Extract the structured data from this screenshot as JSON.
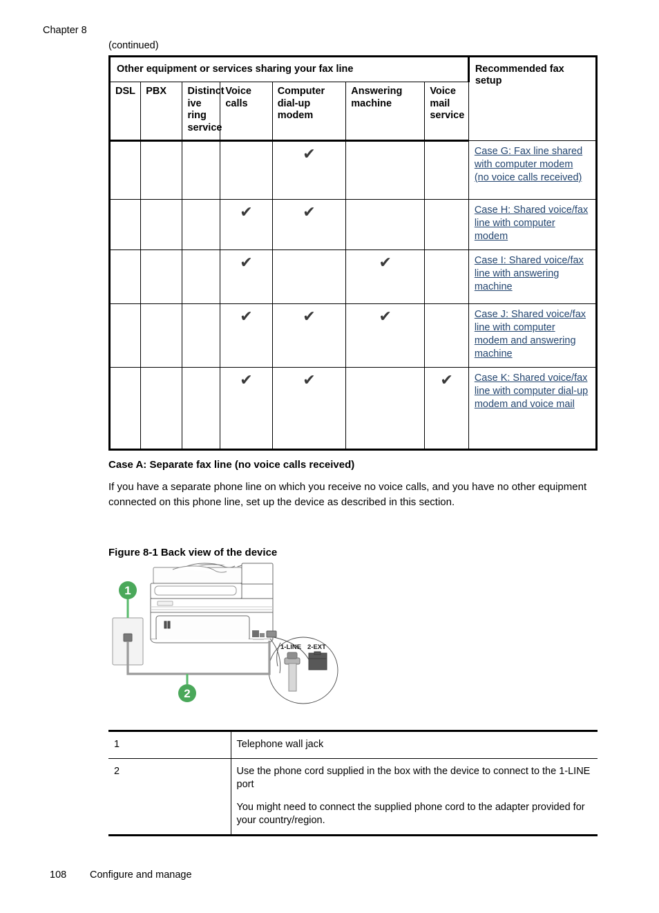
{
  "page": {
    "chapter": "Chapter 8",
    "continued": "(continued)",
    "footer_page_number": "108",
    "footer_section": "Configure and manage"
  },
  "fax_table": {
    "group_header": "Other equipment or services sharing your fax line",
    "recommended_header": "Recommended fax setup",
    "columns": [
      "DSL",
      "PBX",
      "Distinct ive ring service",
      "Voice calls",
      "Computer dial-up modem",
      "Answering machine",
      "Voice mail service"
    ],
    "check_glyph": "✔",
    "link_color": "#23456f",
    "rows": [
      {
        "checks": [
          false,
          false,
          false,
          false,
          true,
          false,
          false
        ],
        "recommendation": "Case G: Fax line shared with computer modem (no voice calls received)"
      },
      {
        "checks": [
          false,
          false,
          false,
          true,
          true,
          false,
          false
        ],
        "recommendation": "Case H: Shared voice/fax line with computer modem"
      },
      {
        "checks": [
          false,
          false,
          false,
          true,
          false,
          true,
          false
        ],
        "recommendation": "Case I: Shared voice/fax line with answering machine"
      },
      {
        "checks": [
          false,
          false,
          false,
          true,
          true,
          true,
          false
        ],
        "recommendation": "Case J: Shared voice/fax line with computer modem and answering machine"
      },
      {
        "checks": [
          false,
          false,
          false,
          true,
          true,
          false,
          true
        ],
        "recommendation": "Case K: Shared voice/fax line with computer dial-up modem and voice mail"
      }
    ]
  },
  "case_a": {
    "heading": "Case A: Separate fax line (no voice calls received)",
    "paragraph": "If you have a separate phone line on which you receive no voice calls, and you have no other equipment connected on this phone line, set up the device as described in this section."
  },
  "figure": {
    "caption": "Figure 8-1 Back view of the device",
    "callout_1": "1",
    "callout_2": "2",
    "port_label_line": "1-LINE",
    "port_label_ext": "2-EXT",
    "callout_color": "#4aa85a"
  },
  "legend": {
    "rows": [
      {
        "number": "1",
        "paragraphs": [
          "Telephone wall jack"
        ]
      },
      {
        "number": "2",
        "paragraphs": [
          "Use the phone cord supplied in the box with the device to connect to the 1-LINE port",
          "You might need to connect the supplied phone cord to the adapter provided for your country/region."
        ]
      }
    ]
  }
}
